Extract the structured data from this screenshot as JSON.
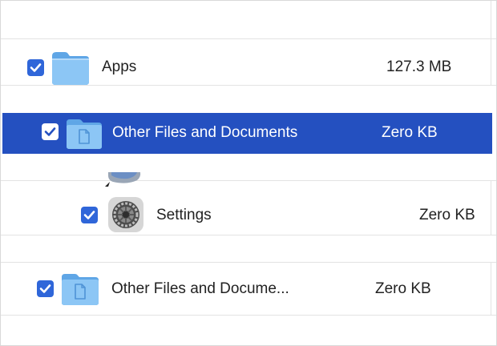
{
  "rows": [
    {
      "label": "Apps",
      "size": "127.3 MB",
      "checked": true,
      "icon": "folder-icon"
    },
    {
      "label": "Other Files and Documents",
      "size": "Zero KB",
      "checked": true,
      "selected": true,
      "icon": "document-folder-icon"
    },
    {
      "label": "Settings",
      "size": "Zero KB",
      "checked": true,
      "icon": "settings-gear-icon"
    },
    {
      "label": "Other Files and Docume...",
      "size": "Zero KB",
      "checked": true,
      "icon": "document-folder-icon"
    }
  ],
  "colors": {
    "selection": "#2450c0",
    "checkbox": "#2f66d9",
    "folder": "#7fbdf2",
    "divider": "#e3e3e3"
  }
}
